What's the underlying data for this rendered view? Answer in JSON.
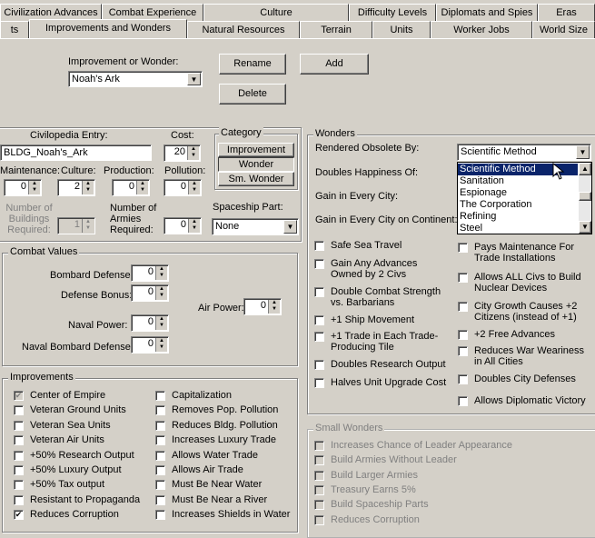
{
  "tabs_row1": [
    "Civilization Advances",
    "Combat Experience",
    "Culture",
    "Difficulty Levels",
    "Diplomats and Spies",
    "Eras"
  ],
  "tabs_row2": [
    "ts",
    "Improvements and Wonders",
    "Natural Resources",
    "Terrain",
    "Units",
    "Worker Jobs",
    "World Size"
  ],
  "selector": {
    "label": "Improvement or Wonder:",
    "value": "Noah's Ark",
    "rename": "Rename",
    "add": "Add",
    "delete": "Delete"
  },
  "civ": {
    "entry_label": "Civilopedia Entry:",
    "entry_value": "BLDG_Noah's_Ark",
    "cost_label": "Cost:",
    "cost": "20",
    "maintenance_label": "Maintenance:",
    "maintenance": "0",
    "culture_label": "Culture:",
    "culture": "2",
    "production_label": "Production:",
    "production": "0",
    "pollution_label": "Pollution:",
    "pollution": "0",
    "buildings_label": "Number of Buildings Required:",
    "buildings": "1",
    "armies_label": "Number of Armies Required:",
    "armies": "0",
    "spaceship_label": "Spaceship Part:",
    "spaceship": "None"
  },
  "category": {
    "title": "Category",
    "improvement": "Improvement",
    "wonder": "Wonder",
    "small": "Sm. Wonder"
  },
  "combat": {
    "title": "Combat Values",
    "bombard_label": "Bombard Defense:",
    "bombard": "0",
    "defense_label": "Defense Bonus:",
    "defense": "0",
    "naval_label": "Naval Power:",
    "naval": "0",
    "naval_bombard_label": "Naval Bombard Defense:",
    "naval_bombard": "0",
    "air_label": "Air Power:",
    "air": "0"
  },
  "improvements": {
    "title": "Improvements",
    "left": [
      {
        "label": "Center of Empire",
        "checked": true,
        "grey": true
      },
      {
        "label": "Veteran Ground Units",
        "checked": false
      },
      {
        "label": "Veteran Sea Units",
        "checked": false
      },
      {
        "label": "Veteran Air Units",
        "checked": false
      },
      {
        "label": "+50% Research Output",
        "checked": false
      },
      {
        "label": "+50% Luxury Output",
        "checked": false
      },
      {
        "label": "+50% Tax output",
        "checked": false
      },
      {
        "label": "Resistant to Propaganda",
        "checked": false
      },
      {
        "label": "Reduces Corruption",
        "checked": true
      }
    ],
    "right": [
      {
        "label": "Capitalization",
        "checked": false
      },
      {
        "label": "Removes Pop. Pollution",
        "checked": false
      },
      {
        "label": "Reduces Bldg. Pollution",
        "checked": false
      },
      {
        "label": "Increases Luxury Trade",
        "checked": false
      },
      {
        "label": "Allows Water Trade",
        "checked": false
      },
      {
        "label": "Allows Air Trade",
        "checked": false
      },
      {
        "label": "Must Be Near Water",
        "checked": false
      },
      {
        "label": "Must Be Near a River",
        "checked": false
      },
      {
        "label": "Increases Shields in Water",
        "checked": false
      }
    ]
  },
  "wonders": {
    "title": "Wonders",
    "obsolete_label": "Rendered Obsolete By:",
    "obsolete_value": "Scientific Method",
    "doubles_label": "Doubles Happiness Of:",
    "gain_label": "Gain in Every City:",
    "gain_continent_label": "Gain in Every City on Continent:",
    "dropdown": [
      "Scientific Method",
      "Sanitation",
      "Espionage",
      "The Corporation",
      "Refining",
      "Steel"
    ],
    "left": [
      "Safe Sea Travel",
      "Gain Any Advances Owned by 2 Civs",
      "Double Combat Strength vs. Barbarians",
      "+1 Ship Movement",
      "+1 Trade in Each Trade-Producing Tile",
      "Doubles Research Output",
      "Halves Unit Upgrade Cost"
    ],
    "right": [
      "Pays Maintenance For Trade Installations",
      "Allows ALL Civs to Build Nuclear Devices",
      "City Growth Causes +2 Citizens (instead of +1)",
      "+2 Free Advances",
      "Reduces War Weariness in All Cities",
      "Doubles City Defenses",
      "Allows Diplomatic Victory"
    ]
  },
  "small_wonders": {
    "title": "Small Wonders",
    "items": [
      "Increases Chance of Leader Appearance",
      "Build Armies Without Leader",
      "Build Larger Armies",
      "Treasury Earns 5%",
      "Build Spaceship Parts",
      "Reduces Corruption"
    ]
  }
}
